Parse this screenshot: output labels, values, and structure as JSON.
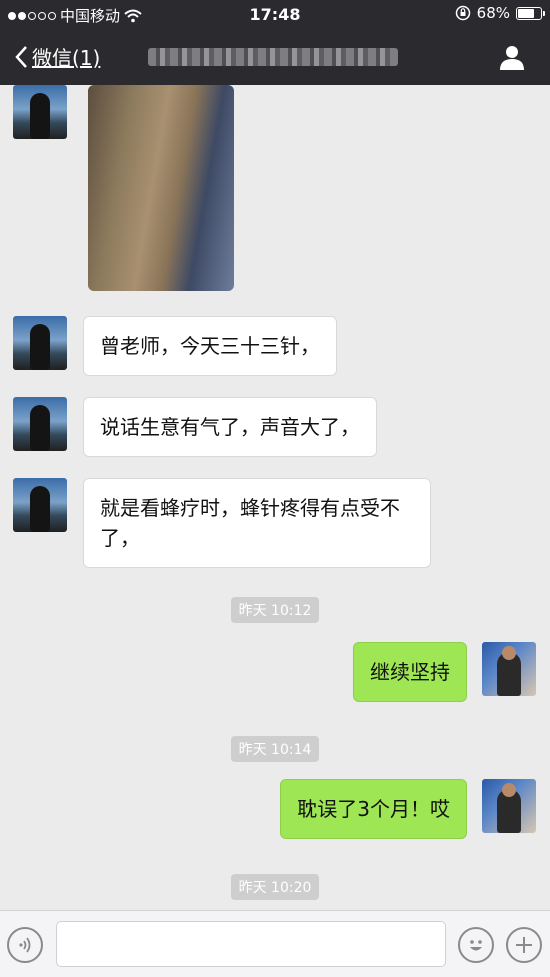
{
  "status_bar": {
    "carrier": "中国移动",
    "time": "17:48",
    "battery": "68%",
    "signal_bars_filled": 2,
    "signal_bars_total": 5,
    "battery_level": 0.68
  },
  "nav": {
    "back_label": "微信(1)"
  },
  "messages": {
    "m1": "曾老师，今天三十三针，",
    "m2": "说话生意有气了，声音大了，",
    "m3_line1": "就是看蜂疗时，蜂针疼得有点受不",
    "m3_line2": "了，",
    "m4": "继续坚持",
    "m5": "耽误了3个月！哎"
  },
  "timestamps": {
    "t1": "昨天 10:12",
    "t2": "昨天 10:14",
    "t3": "昨天 10:20"
  },
  "input": {
    "placeholder": ""
  },
  "colors": {
    "bar_bg": "#2b2b2f",
    "chat_bg": "#ebebeb",
    "outgoing_bubble": "#9ee653",
    "incoming_bubble": "#ffffff"
  }
}
